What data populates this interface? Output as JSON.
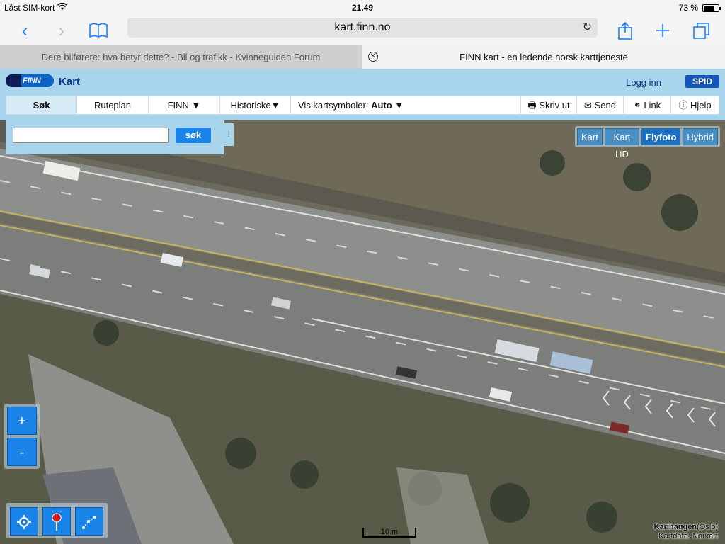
{
  "statusbar": {
    "carrier": "Låst SIM-kort",
    "time": "21.49",
    "battery_text": "73 %",
    "battery_level": 0.73
  },
  "browser": {
    "url": "kart.finn.no"
  },
  "tabs": [
    {
      "label": "Dere bilførere: hva betyr dette? - Bil og trafikk - Kvinneguiden Forum",
      "active": false
    },
    {
      "label": "FINN kart - en ledende norsk karttjeneste",
      "active": true
    }
  ],
  "header": {
    "logo_text": "FINN",
    "title": "Kart",
    "login": "Logg inn",
    "spid": "SPID"
  },
  "nav": {
    "search": "Søk",
    "route": "Ruteplan",
    "finn": "FINN ▼",
    "historic": "Historiske▼",
    "symbols_label": "Vis kartsymboler:",
    "symbols_value": "Auto ▼",
    "print": "Skriv ut",
    "send": "Send",
    "link": "Link",
    "help": "Hjelp"
  },
  "search": {
    "value": "",
    "button": "søk"
  },
  "map_types": [
    "Kart",
    "Kart HD",
    "Flyfoto",
    "Hybrid"
  ],
  "map_types_selected": "Flyfoto",
  "zoom": {
    "in": "+",
    "out": "-"
  },
  "scale": "10 m",
  "attribution": {
    "place": "Karihaugen",
    "place_suffix": "(Oslo)",
    "data": "Kartdata: Norkart"
  }
}
